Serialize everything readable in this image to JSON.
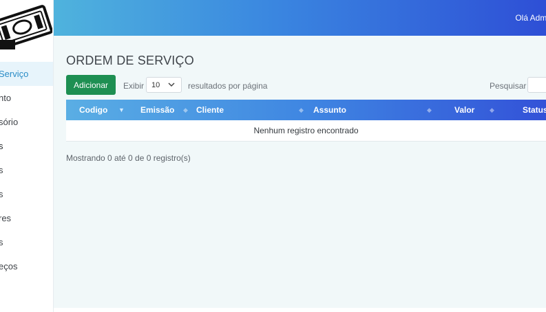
{
  "header": {
    "greeting": "Olá Admi"
  },
  "sidebar": {
    "items": [
      {
        "label": "Serviço",
        "active": true
      },
      {
        "label": "nto"
      },
      {
        "label": "sório"
      },
      {
        "label": "s"
      },
      {
        "label": "s"
      },
      {
        "label": "s"
      },
      {
        "label": "res"
      },
      {
        "label": "s"
      },
      {
        "label": "eços"
      }
    ]
  },
  "page": {
    "title": "ORDEM DE SERVIÇO",
    "add_label": "Adicionar",
    "show_label": "Exibir",
    "page_size": "10",
    "per_page_label": "resultados por página",
    "search_label": "Pesquisar",
    "search_value": ""
  },
  "table": {
    "columns": [
      "Codigo",
      "Emissão",
      "Cliente",
      "Assunto",
      "Valor",
      "Status"
    ],
    "empty_message": "Nenhum registro encontrado"
  },
  "pagination": {
    "info": "Mostrando 0 até 0 de 0 registro(s)"
  },
  "colors": {
    "accent": "#2e4fd6",
    "header_start": "#4fb3dd",
    "add_button": "#1e8f52",
    "active_item_bg": "#e7f4fb"
  },
  "icons": {
    "logo": "cash-logo-icon",
    "sort": "sort-arrows-icon",
    "chevron": "chevron-down-icon"
  }
}
